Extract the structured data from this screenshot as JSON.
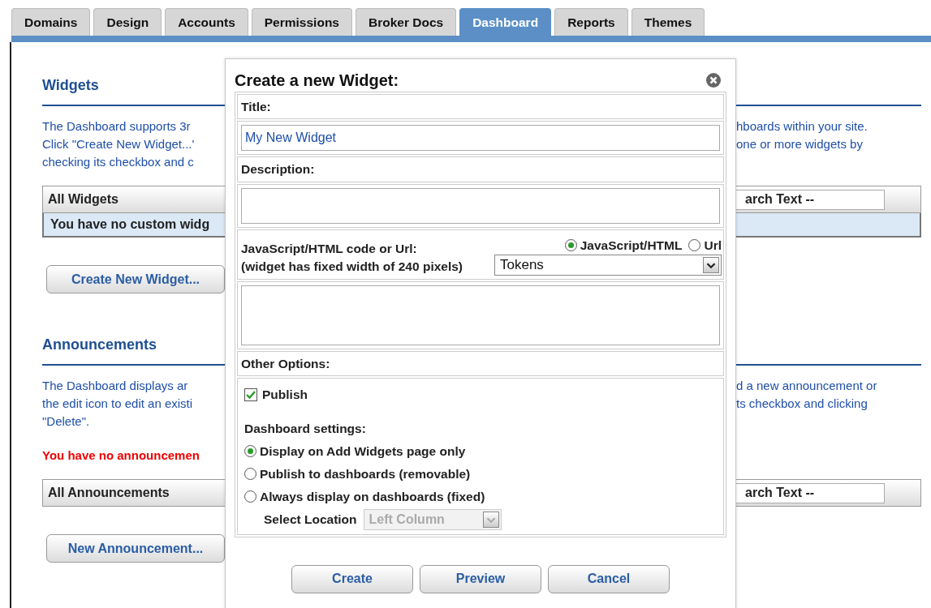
{
  "tabs": [
    {
      "label": "Domains",
      "selected": false
    },
    {
      "label": "Design",
      "selected": false
    },
    {
      "label": "Accounts",
      "selected": false
    },
    {
      "label": "Permissions",
      "selected": false
    },
    {
      "label": "Broker Docs",
      "selected": false
    },
    {
      "label": "Dashboard",
      "selected": true
    },
    {
      "label": "Reports",
      "selected": false
    },
    {
      "label": "Themes",
      "selected": false
    }
  ],
  "sections": [
    {
      "heading": "Widgets",
      "lines": [
        {
          "left": "The Dashboard supports 3r",
          "right": "hboards within your site."
        },
        {
          "left": "Click \"Create New Widget...'",
          "right": "one or more widgets by"
        },
        {
          "left": "checking its checkbox and c"
        }
      ],
      "table": {
        "header": "All Widgets",
        "search_value": "arch Text --",
        "empty_row": "You have no custom widg"
      },
      "button": "Create New Widget..."
    },
    {
      "heading": "Announcements",
      "lines": [
        {
          "left": "The Dashboard displays ar",
          "right": "d a new announcement or"
        },
        {
          "left": "the edit icon to edit an existi",
          "right": "ts checkbox and clicking"
        },
        {
          "left": "\"Delete\"."
        }
      ],
      "notice": "You have no announcemen",
      "table": {
        "header": "All Announcements",
        "search_value": "arch Text --"
      },
      "button": "New Announcement..."
    }
  ],
  "dialog": {
    "title": "Create a new Widget:",
    "title_label": "Title:",
    "title_value": "My New Widget",
    "description_label": "Description:",
    "code_label": [
      "JavaScript/HTML code or Url:",
      "(widget has fixed width of 240 pixels)"
    ],
    "code_types": [
      {
        "label": "JavaScript/HTML",
        "selected": true
      },
      {
        "label": "Url",
        "selected": false
      }
    ],
    "tokens_value": "Tokens",
    "other_label": "Other Options:",
    "publish": {
      "label": "Publish",
      "checked": true
    },
    "settings_label": "Dashboard settings:",
    "settings": [
      {
        "label": "Display on Add Widgets page only",
        "selected": true
      },
      {
        "label": "Publish to dashboards (removable)",
        "selected": false
      },
      {
        "label": "Always display on dashboards (fixed)",
        "selected": false
      }
    ],
    "location": {
      "label": "Select Location",
      "value": "Left Column",
      "disabled": true
    },
    "buttons": [
      "Create",
      "Preview",
      "Cancel"
    ]
  }
}
